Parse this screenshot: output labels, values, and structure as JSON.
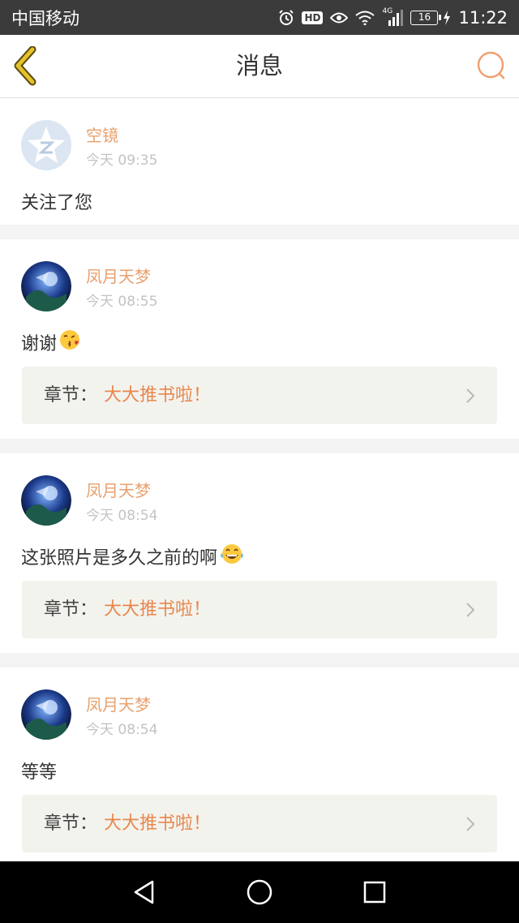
{
  "status_bar": {
    "carrier": "中国移动",
    "network": "4G",
    "battery": "16",
    "time": "11:22",
    "hd_label": "HD",
    "icons": [
      "alarm-icon",
      "hd-icon",
      "eye-icon",
      "wifi-icon",
      "signal-icon",
      "battery-icon",
      "charging-icon"
    ]
  },
  "header": {
    "title": "消息",
    "back_icon": "chevron-left-icon",
    "search_icon": "search-icon"
  },
  "colors": {
    "accent": "#e8874d",
    "username": "#e8a06e",
    "back_icon": "#d9b21a",
    "search_icon": "#f0a070"
  },
  "messages": [
    {
      "user": "空镜",
      "time": "今天 09:35",
      "text": "关注了您",
      "avatar": "default-avatar",
      "emoji": null,
      "chapter": null
    },
    {
      "user": "凤月天梦",
      "time": "今天 08:55",
      "text": "谢谢",
      "avatar": "user-avatar",
      "emoji": "kiss-emoji",
      "chapter": {
        "label": "章节：",
        "title": "大大推书啦！"
      }
    },
    {
      "user": "凤月天梦",
      "time": "今天 08:54",
      "text": "这张照片是多久之前的啊",
      "avatar": "user-avatar",
      "emoji": "laughing-tears-emoji",
      "chapter": {
        "label": "章节：",
        "title": "大大推书啦！"
      }
    },
    {
      "user": "凤月天梦",
      "time": "今天 08:54",
      "text": "等等",
      "avatar": "user-avatar",
      "emoji": null,
      "chapter": {
        "label": "章节：",
        "title": "大大推书啦！"
      }
    }
  ],
  "system_nav": {
    "buttons": [
      "back-triangle-icon",
      "home-circle-icon",
      "recents-square-icon"
    ]
  }
}
